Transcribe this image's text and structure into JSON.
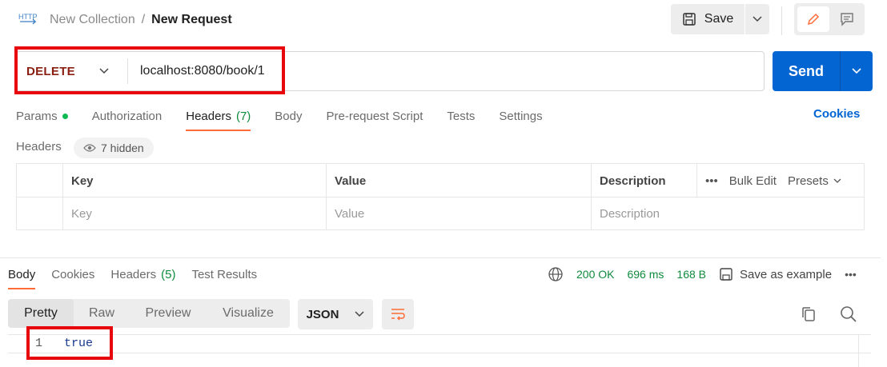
{
  "breadcrumb": {
    "collection": "New Collection",
    "separator": "/",
    "request": "New Request"
  },
  "toolbar": {
    "save_label": "Save"
  },
  "request": {
    "method": "DELETE",
    "url": "localhost:8080/book/1",
    "send_label": "Send"
  },
  "request_tabs": [
    {
      "label": "Params",
      "count": "",
      "dot": true
    },
    {
      "label": "Authorization",
      "count": ""
    },
    {
      "label": "Headers",
      "count": "(7)",
      "active": true
    },
    {
      "label": "Body",
      "count": ""
    },
    {
      "label": "Pre-request Script",
      "count": ""
    },
    {
      "label": "Tests",
      "count": ""
    },
    {
      "label": "Settings",
      "count": ""
    }
  ],
  "cookies_link": "Cookies",
  "headers_section": {
    "label": "Headers",
    "hidden_text": "7 hidden"
  },
  "headers_table": {
    "columns": [
      "Key",
      "Value",
      "Description"
    ],
    "placeholders": [
      "Key",
      "Value",
      "Description"
    ],
    "bulk_edit": "Bulk Edit",
    "presets": "Presets"
  },
  "response_tabs": [
    {
      "label": "Body",
      "count": "",
      "active": true
    },
    {
      "label": "Cookies",
      "count": ""
    },
    {
      "label": "Headers",
      "count": "(5)"
    },
    {
      "label": "Test Results",
      "count": ""
    }
  ],
  "response_meta": {
    "status": "200 OK",
    "time": "696 ms",
    "size": "168 B",
    "save_example": "Save as example"
  },
  "view_modes": [
    "Pretty",
    "Raw",
    "Preview",
    "Visualize"
  ],
  "format": "JSON",
  "body_lines": [
    {
      "num": "1",
      "text": "true"
    }
  ],
  "colors": {
    "accent": "#ff6c37",
    "send": "#0265d2",
    "method": "#8a1f11",
    "highlight": "#e8060d",
    "status_ok": "#0f8a3c"
  }
}
